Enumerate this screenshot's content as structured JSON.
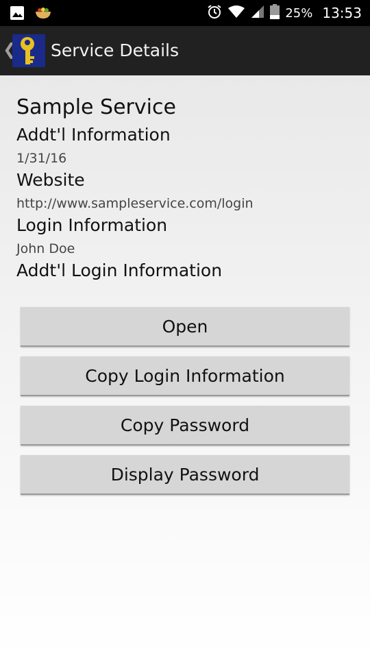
{
  "status_bar": {
    "battery_percent": "25%",
    "time": "13:53"
  },
  "action_bar": {
    "title": "Service Details"
  },
  "details": {
    "service_name": "Sample Service",
    "addtl_info_label": "Addt'l Information",
    "addtl_info_value": "1/31/16",
    "website_label": "Website",
    "website_value": "http://www.sampleservice.com/login",
    "login_info_label": "Login Information",
    "login_info_value": "John Doe",
    "addtl_login_info_label": "Addt'l Login Information"
  },
  "buttons": {
    "open": "Open",
    "copy_login": "Copy Login Information",
    "copy_password": "Copy Password",
    "display_password": "Display Password"
  }
}
